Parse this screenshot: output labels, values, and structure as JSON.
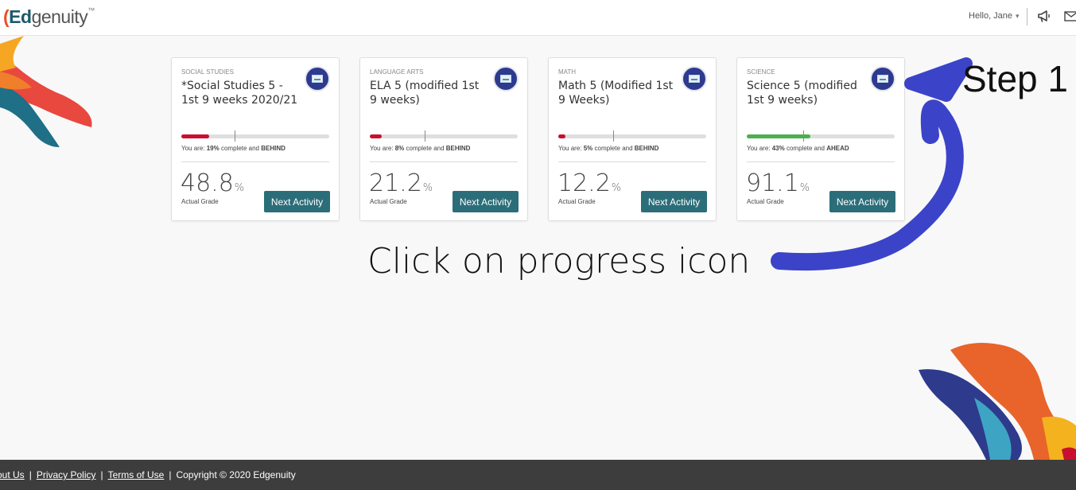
{
  "header": {
    "logo_mark": "ᴋ",
    "logo_ed": "Ed",
    "logo_rest": "genuity",
    "logo_tm": "™",
    "greeting": "Hello, Jane",
    "caret": "▾"
  },
  "courses": [
    {
      "subject": "SOCIAL STUDIES",
      "title": "*Social Studies 5 - 1st 9 weeks 2020/21",
      "progress_percent": 19,
      "target_percent": 36,
      "bar_color": "#c8102e",
      "status_prefix": "You are: ",
      "status_pct": "19%",
      "status_mid": " complete and ",
      "status_state": "BEHIND",
      "grade": "48.8",
      "grade_unit": "%",
      "grade_label": "Actual Grade",
      "button": "Next Activity"
    },
    {
      "subject": "LANGUAGE ARTS",
      "title": "ELA 5 (modified 1st 9 weeks)",
      "progress_percent": 8,
      "target_percent": 37,
      "bar_color": "#c8102e",
      "status_prefix": "You are: ",
      "status_pct": "8%",
      "status_mid": " complete and ",
      "status_state": "BEHIND",
      "grade": "21.2",
      "grade_unit": "%",
      "grade_label": "Actual Grade",
      "button": "Next Activity"
    },
    {
      "subject": "MATH",
      "title": "Math 5 (Modified 1st 9 Weeks)",
      "progress_percent": 5,
      "target_percent": 37,
      "bar_color": "#c8102e",
      "status_prefix": "You are: ",
      "status_pct": "5%",
      "status_mid": " complete and ",
      "status_state": "BEHIND",
      "grade": "12.2",
      "grade_unit": "%",
      "grade_label": "Actual Grade",
      "button": "Next Activity"
    },
    {
      "subject": "SCIENCE",
      "title": "Science 5 (modified 1st 9 weeks)",
      "progress_percent": 43,
      "target_percent": 38,
      "bar_color": "#4caf50",
      "status_prefix": "You are: ",
      "status_pct": "43%",
      "status_mid": " complete and ",
      "status_state": "AHEAD",
      "grade": "91.1",
      "grade_unit": "%",
      "grade_label": "Actual Grade",
      "button": "Next Activity"
    }
  ],
  "annotation": {
    "step": "Step 1",
    "instruction": "Click on progress icon",
    "arrow_color": "#3b44c8"
  },
  "footer": {
    "about": "out Us",
    "privacy": "Privacy Policy",
    "terms": "Terms of Use",
    "copyright": "Copyright © 2020 Edgenuity",
    "sep": "|"
  },
  "colors": {
    "brand_teal": "#2b6e7a",
    "brand_orange": "#e8502a",
    "footer_bg": "#3d3d3d"
  }
}
